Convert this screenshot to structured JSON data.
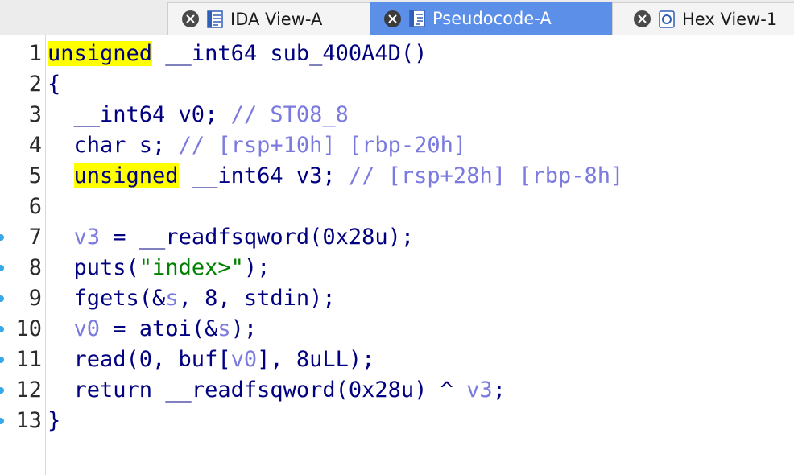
{
  "tabs": [
    {
      "label": "IDA View-A",
      "icon": "disassembly-view-icon",
      "active": false
    },
    {
      "label": "Pseudocode-A",
      "icon": "pseudocode-view-icon",
      "active": true
    },
    {
      "label": "Hex View-1",
      "icon": "hex-view-icon",
      "active": false
    }
  ],
  "colors": {
    "active_tab": "#5b8fe8",
    "keyword_highlight": "#ffff00",
    "code_default": "#000080",
    "comment": "#7b7bdf",
    "string": "#008000",
    "breakpoint_marker": "#39a8e8"
  },
  "lines": [
    {
      "num": "1",
      "marker": false,
      "tokens": [
        {
          "t": "unsigned",
          "c": "kw-hl"
        },
        {
          "t": " __int64 sub_400A4D()",
          "c": "default"
        }
      ]
    },
    {
      "num": "2",
      "marker": false,
      "tokens": [
        {
          "t": "{",
          "c": "default"
        }
      ]
    },
    {
      "num": "3",
      "marker": false,
      "tokens": [
        {
          "t": "  __int64 v0; ",
          "c": "default"
        },
        {
          "t": "// ST08_8",
          "c": "comment"
        }
      ]
    },
    {
      "num": "4",
      "marker": false,
      "tokens": [
        {
          "t": "  char s; ",
          "c": "default"
        },
        {
          "t": "// [rsp+10h] [rbp-20h]",
          "c": "comment"
        }
      ]
    },
    {
      "num": "5",
      "marker": false,
      "tokens": [
        {
          "t": "  ",
          "c": "default"
        },
        {
          "t": "unsigned",
          "c": "kw-hl"
        },
        {
          "t": " __int64 v3; ",
          "c": "default"
        },
        {
          "t": "// [rsp+28h] [rbp-8h]",
          "c": "comment"
        }
      ]
    },
    {
      "num": "6",
      "marker": false,
      "tokens": []
    },
    {
      "num": "7",
      "marker": true,
      "tokens": [
        {
          "t": "  v3",
          "c": "var"
        },
        {
          "t": " = __readfsqword(0x28u);",
          "c": "default"
        }
      ]
    },
    {
      "num": "8",
      "marker": true,
      "tokens": [
        {
          "t": "  puts(",
          "c": "default"
        },
        {
          "t": "\"index>\"",
          "c": "string"
        },
        {
          "t": ");",
          "c": "default"
        }
      ]
    },
    {
      "num": "9",
      "marker": true,
      "tokens": [
        {
          "t": "  fgets(&",
          "c": "default"
        },
        {
          "t": "s",
          "c": "var"
        },
        {
          "t": ", 8, stdin);",
          "c": "default"
        }
      ]
    },
    {
      "num": "10",
      "marker": true,
      "tokens": [
        {
          "t": "  v0",
          "c": "var"
        },
        {
          "t": " = atoi(&",
          "c": "default"
        },
        {
          "t": "s",
          "c": "var"
        },
        {
          "t": ");",
          "c": "default"
        }
      ]
    },
    {
      "num": "11",
      "marker": true,
      "tokens": [
        {
          "t": "  read(0, buf[",
          "c": "default"
        },
        {
          "t": "v0",
          "c": "var"
        },
        {
          "t": "], 8uLL);",
          "c": "default"
        }
      ]
    },
    {
      "num": "12",
      "marker": true,
      "tokens": [
        {
          "t": "  return __readfsqword(0x28u) ^ ",
          "c": "default"
        },
        {
          "t": "v3",
          "c": "var"
        },
        {
          "t": ";",
          "c": "default"
        }
      ]
    },
    {
      "num": "13",
      "marker": true,
      "tokens": [
        {
          "t": "}",
          "c": "default"
        }
      ]
    }
  ]
}
